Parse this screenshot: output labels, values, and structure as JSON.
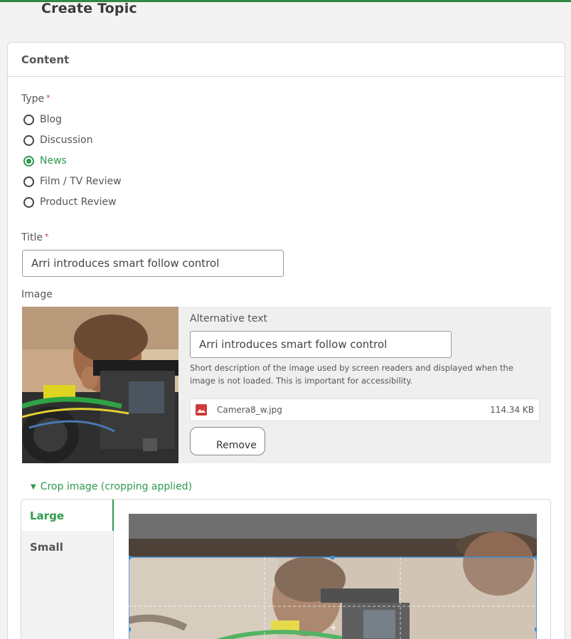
{
  "page": {
    "title": "Create Topic"
  },
  "content_card": {
    "header": "Content"
  },
  "type_field": {
    "label": "Type",
    "required_mark": "*",
    "options": [
      {
        "label": "Blog",
        "checked": false
      },
      {
        "label": "Discussion",
        "checked": false
      },
      {
        "label": "News",
        "checked": true
      },
      {
        "label": "Film / TV Review",
        "checked": false
      },
      {
        "label": "Product Review",
        "checked": false
      }
    ]
  },
  "title_field": {
    "label": "Title",
    "required_mark": "*",
    "value": "Arri introduces smart follow control"
  },
  "image_field": {
    "label": "Image",
    "alt_text_label": "Alternative text",
    "alt_text_value": "Arri introduces smart follow control",
    "help_text": "Short description of the image used by screen readers and displayed when the image is not loaded. This is important for accessibility.",
    "file_name": "Camera8_w.jpg",
    "file_size": "114.34 KB",
    "remove_label": "Remove"
  },
  "crop": {
    "toggle_label": "Crop image (cropping applied)",
    "tabs": [
      {
        "label": "Large",
        "active": true
      },
      {
        "label": "Small",
        "active": false
      }
    ]
  },
  "colors": {
    "accent": "#2e9a4c",
    "required": "#d32f2f",
    "file_icon": "#d03b3b",
    "crop_frame": "#3d8fd6"
  }
}
